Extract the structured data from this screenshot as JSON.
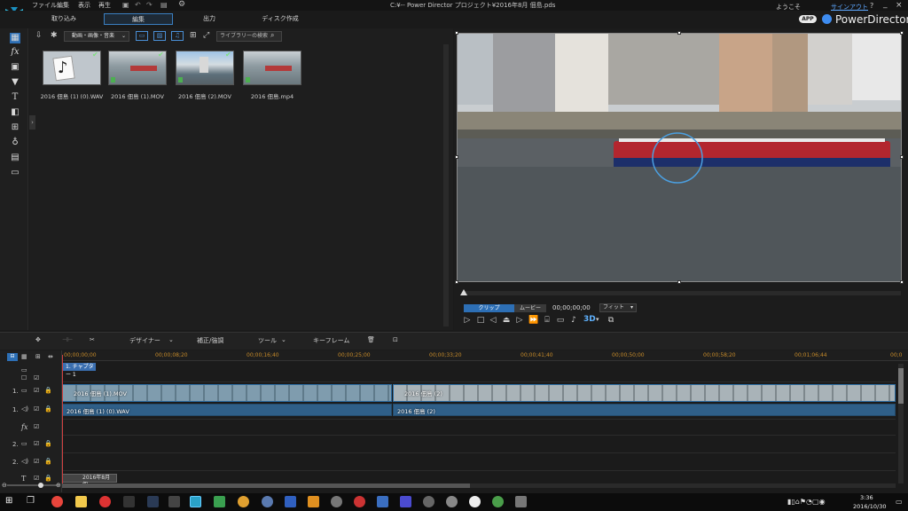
{
  "menu": {
    "items": [
      "ファイル",
      "編集",
      "表示",
      "再生"
    ]
  },
  "window": {
    "title": "C:¥-- Power Director プロジェクト¥2016年8月 佃島.pds",
    "welcome": "ようこそ",
    "signout": "サインアウト",
    "help": "?",
    "minimize": "_",
    "close": "×"
  },
  "tabs": [
    "取り込み",
    "編集",
    "出力",
    "ディスク作成"
  ],
  "branding": {
    "app_badge": "APP",
    "product_name": "PowerDirector"
  },
  "library": {
    "filter_label": "動画・画像・音楽",
    "search_placeholder": "ライブラリーの検索",
    "items": [
      {
        "label": "2016 佃島 (1) (0).WAV",
        "kind": "audio"
      },
      {
        "label": "2016 佃島 (1).MOV",
        "kind": "video"
      },
      {
        "label": "2016 佃島 (2).MOV",
        "kind": "video"
      },
      {
        "label": "2016 佃島.mp4",
        "kind": "video"
      }
    ]
  },
  "preview": {
    "mode_clip": "クリップ",
    "mode_movie": "ムービー",
    "timecode": "00;00;00;00",
    "fit": "フィット",
    "three_d": "3D"
  },
  "edit_toolbar": {
    "designer": "デザイナー",
    "correct": "補正/強調",
    "tools": "ツール",
    "keyframe": "キーフレーム"
  },
  "timeline": {
    "ruler": [
      "00;00;00;00",
      "00;00;08;20",
      "00;00;16;40",
      "00;00;25;00",
      "00;00;33;20",
      "00;00;41;40",
      "00;00;50;00",
      "00;00;58;20",
      "00;01;06;44",
      "00;0"
    ],
    "chapter": "1. チャプター 1",
    "track_labels": [
      "1.",
      "1.",
      "fx",
      "2.",
      "2.",
      "T"
    ],
    "clips": {
      "video1": "2016 佃島 (1).MOV",
      "video2": "2016 佃島 (2)",
      "audio1": "2016 佃島 (1) (0).WAV",
      "audio2": "2016 佃島 (2)",
      "title": "2016年8月 佃"
    }
  },
  "taskbar": {
    "time": "3:36",
    "date": "2016/10/30"
  },
  "colors": {
    "accent": "#3a7fc1",
    "playhead": "#d04040",
    "ruler_text": "#c58a2a"
  }
}
